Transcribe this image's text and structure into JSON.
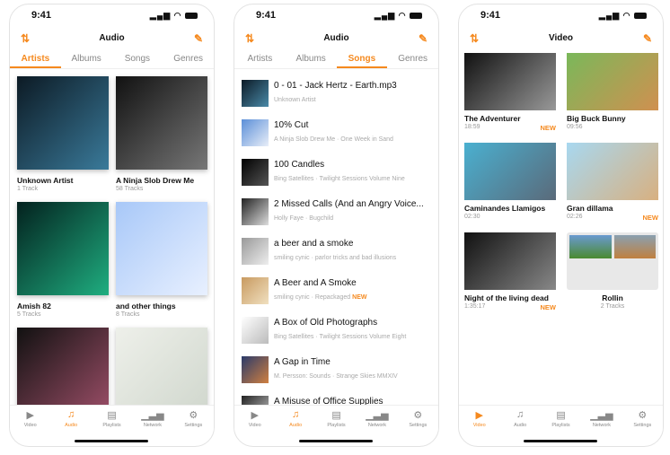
{
  "accent": "#f5891e",
  "status": {
    "time": "9:41"
  },
  "tabbar": [
    {
      "label": "Video",
      "icon": "video-icon",
      "glyph": "▶"
    },
    {
      "label": "Audio",
      "icon": "music-note-icon",
      "glyph": "♫"
    },
    {
      "label": "Playlists",
      "icon": "playlist-icon",
      "glyph": "▤"
    },
    {
      "label": "Network",
      "icon": "network-icon",
      "glyph": "▁▃▅"
    },
    {
      "label": "Settings",
      "icon": "gear-icon",
      "glyph": "⚙"
    }
  ],
  "audio_tabs": [
    "Artists",
    "Albums",
    "Songs",
    "Genres"
  ],
  "screens": [
    {
      "title": "Audio",
      "active_tab": 0,
      "active_bar": 1
    },
    {
      "title": "Audio",
      "active_tab": 2,
      "active_bar": 1
    },
    {
      "title": "Video",
      "active_bar": 0
    }
  ],
  "artists": [
    {
      "name": "Unknown Artist",
      "sub": "1 Track",
      "colors": [
        "#0c1a24",
        "#3a7a9a"
      ]
    },
    {
      "name": "A Ninja Slob Drew Me",
      "sub": "58 Tracks",
      "colors": [
        "#111",
        "#777"
      ]
    },
    {
      "name": "Amish 82",
      "sub": "5 Tracks",
      "colors": [
        "#03211e",
        "#1fae80"
      ]
    },
    {
      "name": "and other things",
      "sub": "8 Tracks",
      "colors": [
        "#a8c8f8",
        "#e8f0ff"
      ]
    },
    {
      "name": "",
      "sub": "",
      "colors": [
        "#111",
        "#a0506a"
      ]
    },
    {
      "name": "",
      "sub": "",
      "colors": [
        "#eef0ea",
        "#cfd6cc"
      ]
    }
  ],
  "songs": [
    {
      "title": "0 - 01 - Jack Hertz - Earth.mp3",
      "sub": "Unknown Artist",
      "new": "",
      "colors": [
        "#0b1a26",
        "#4a8aa8"
      ]
    },
    {
      "title": "10% Cut",
      "sub": "A Ninja Slob Drew Me · One Week in Sand",
      "new": "",
      "colors": [
        "#5b8fd8",
        "#e8eef8"
      ]
    },
    {
      "title": "100 Candles",
      "sub": "Bing Satellites · Twilight Sessions Volume Nine",
      "new": "",
      "colors": [
        "#000",
        "#555"
      ]
    },
    {
      "title": "2 Missed Calls (And an Angry Voice...",
      "sub": "Holly Faye · Bugchild",
      "new": "",
      "colors": [
        "#222",
        "#ddd"
      ]
    },
    {
      "title": "a beer and a smoke",
      "sub": "smiling cynic · parlor tricks and bad illusions",
      "new": "",
      "colors": [
        "#999",
        "#eee"
      ]
    },
    {
      "title": "A Beer and A Smoke",
      "sub": "smiling cynic · Repackaged",
      "new": "NEW",
      "colors": [
        "#c89a60",
        "#f0e0c0"
      ]
    },
    {
      "title": "A Box of Old Photographs",
      "sub": "Bing Satellites · Twilight Sessions Volume Eight",
      "new": "",
      "colors": [
        "#fff",
        "#bbb"
      ]
    },
    {
      "title": "A Gap in Time",
      "sub": "M. Persson: Sounds · Strange Skies MMXIV",
      "new": "",
      "colors": [
        "#2a3a6a",
        "#d08040"
      ]
    },
    {
      "title": "A Misuse of Office Supplies",
      "sub": "",
      "new": "",
      "colors": [
        "#222",
        "#ccc"
      ]
    }
  ],
  "videos": [
    {
      "title": "The Adventurer",
      "sub": "18:59",
      "new": "NEW",
      "colors": [
        "#111",
        "#999"
      ]
    },
    {
      "title": "Big Buck Bunny",
      "sub": "09:56",
      "new": "",
      "colors": [
        "#7ab85a",
        "#d09050"
      ]
    },
    {
      "title": "Caminandes Llamigos",
      "sub": "02:30",
      "new": "",
      "colors": [
        "#4ab0d0",
        "#5a6a7a"
      ]
    },
    {
      "title": "Gran dillama",
      "sub": "02:26",
      "new": "NEW",
      "colors": [
        "#a8d8f0",
        "#d8b080"
      ]
    },
    {
      "title": "Night of the living dead",
      "sub": "1:35:17",
      "new": "NEW",
      "colors": [
        "#111",
        "#888"
      ]
    },
    {
      "title": "Rollin",
      "sub": "2 Tracks",
      "new": "",
      "colors": [
        "#e8e8e8",
        "#e8e8e8"
      ]
    }
  ]
}
